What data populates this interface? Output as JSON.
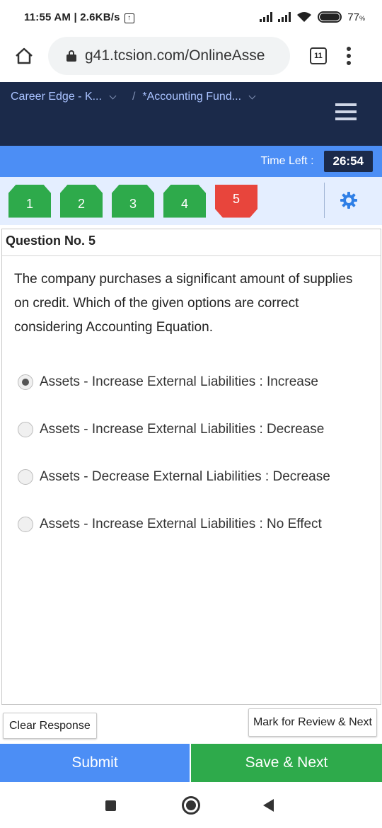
{
  "status_bar": {
    "time_speed": "11:55 AM | 2.6KB/s",
    "upload_icon": "upload-arrow-icon",
    "battery_percent": "77",
    "battery_unit": "%"
  },
  "browser": {
    "url": "g41.tcsion.com/OnlineAsse",
    "tab_count": "11"
  },
  "header": {
    "breadcrumb_course": "Career Edge - K...",
    "breadcrumb_separator": "/",
    "breadcrumb_module": "*Accounting Fund..."
  },
  "timer": {
    "label": "Time Left :",
    "value": "26:54"
  },
  "palette": {
    "questions": [
      {
        "number": "1",
        "status": "answered"
      },
      {
        "number": "2",
        "status": "answered"
      },
      {
        "number": "3",
        "status": "answered"
      },
      {
        "number": "4",
        "status": "answered"
      },
      {
        "number": "5",
        "status": "current"
      }
    ]
  },
  "question": {
    "title": "Question No. 5",
    "text": "The company purchases a significant amount of supplies on credit. Which of the given options are correct considering Accounting Equation.",
    "selected_index": 0,
    "options": [
      "Assets - Increase External Liabilities : Increase",
      "Assets - Increase External Liabilities : Decrease",
      "Assets - Decrease External Liabilities : Decrease",
      "Assets - Increase External Liabilities : No Effect"
    ]
  },
  "actions": {
    "clear_label": "Clear Response",
    "mark_label": "Mark for Review & Next",
    "submit_label": "Submit",
    "save_next_label": "Save & Next"
  },
  "colors": {
    "header_navy": "#1b2a4a",
    "timer_blue": "#4c8ef5",
    "answered_green": "#2eaa4b",
    "current_red": "#e8453c",
    "palette_bg": "#e4eeff"
  }
}
